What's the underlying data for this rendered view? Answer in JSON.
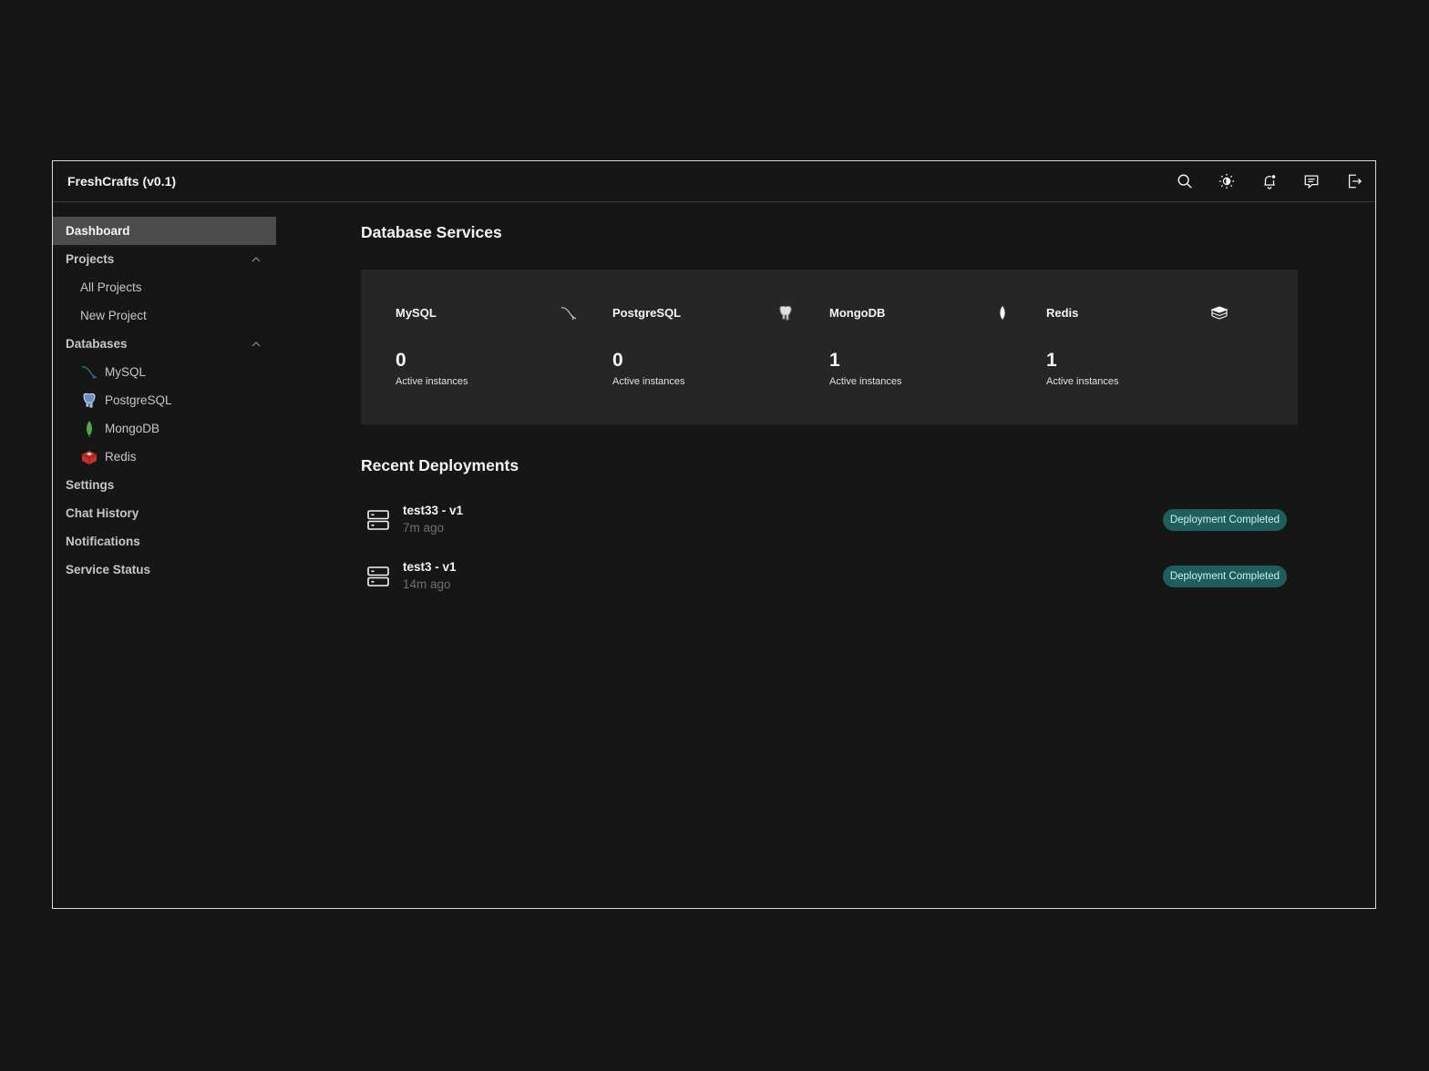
{
  "app": {
    "title": "FreshCrafts (v0.1)"
  },
  "header": {
    "actions": [
      {
        "icon": "search-icon"
      },
      {
        "icon": "theme-icon"
      },
      {
        "icon": "notification-icon"
      },
      {
        "icon": "chat-icon"
      },
      {
        "icon": "logout-icon"
      }
    ]
  },
  "sidebar": {
    "dashboard": "Dashboard",
    "projects": {
      "label": "Projects",
      "items": [
        "All Projects",
        "New Project"
      ]
    },
    "databases": {
      "label": "Databases",
      "items": [
        {
          "label": "MySQL",
          "icon": "mysql-icon"
        },
        {
          "label": "PostgreSQL",
          "icon": "postgresql-icon"
        },
        {
          "label": "MongoDB",
          "icon": "mongodb-icon"
        },
        {
          "label": "Redis",
          "icon": "redis-icon"
        }
      ]
    },
    "settings": "Settings",
    "chat_history": "Chat History",
    "notifications": "Notifications",
    "service_status": "Service Status"
  },
  "database_services": {
    "title": "Database Services",
    "cards": [
      {
        "name": "MySQL",
        "count": "0",
        "sub": "Active instances",
        "icon": "mysql-icon"
      },
      {
        "name": "PostgreSQL",
        "count": "0",
        "sub": "Active instances",
        "icon": "postgresql-icon"
      },
      {
        "name": "MongoDB",
        "count": "1",
        "sub": "Active instances",
        "icon": "mongodb-icon"
      },
      {
        "name": "Redis",
        "count": "1",
        "sub": "Active instances",
        "icon": "redis-icon"
      }
    ]
  },
  "recent_deployments": {
    "title": "Recent Deployments",
    "items": [
      {
        "name": "test33 - v1",
        "ago": "7m ago",
        "status": "Deployment Completed"
      },
      {
        "name": "test3 - v1",
        "ago": "14m ago",
        "status": "Deployment Completed"
      }
    ]
  },
  "colors": {
    "background": "#161616",
    "panel": "#262626",
    "active_nav": "#4c4c4c",
    "badge_bg": "#1f5e5e",
    "badge_text": "#c9f0ec"
  }
}
